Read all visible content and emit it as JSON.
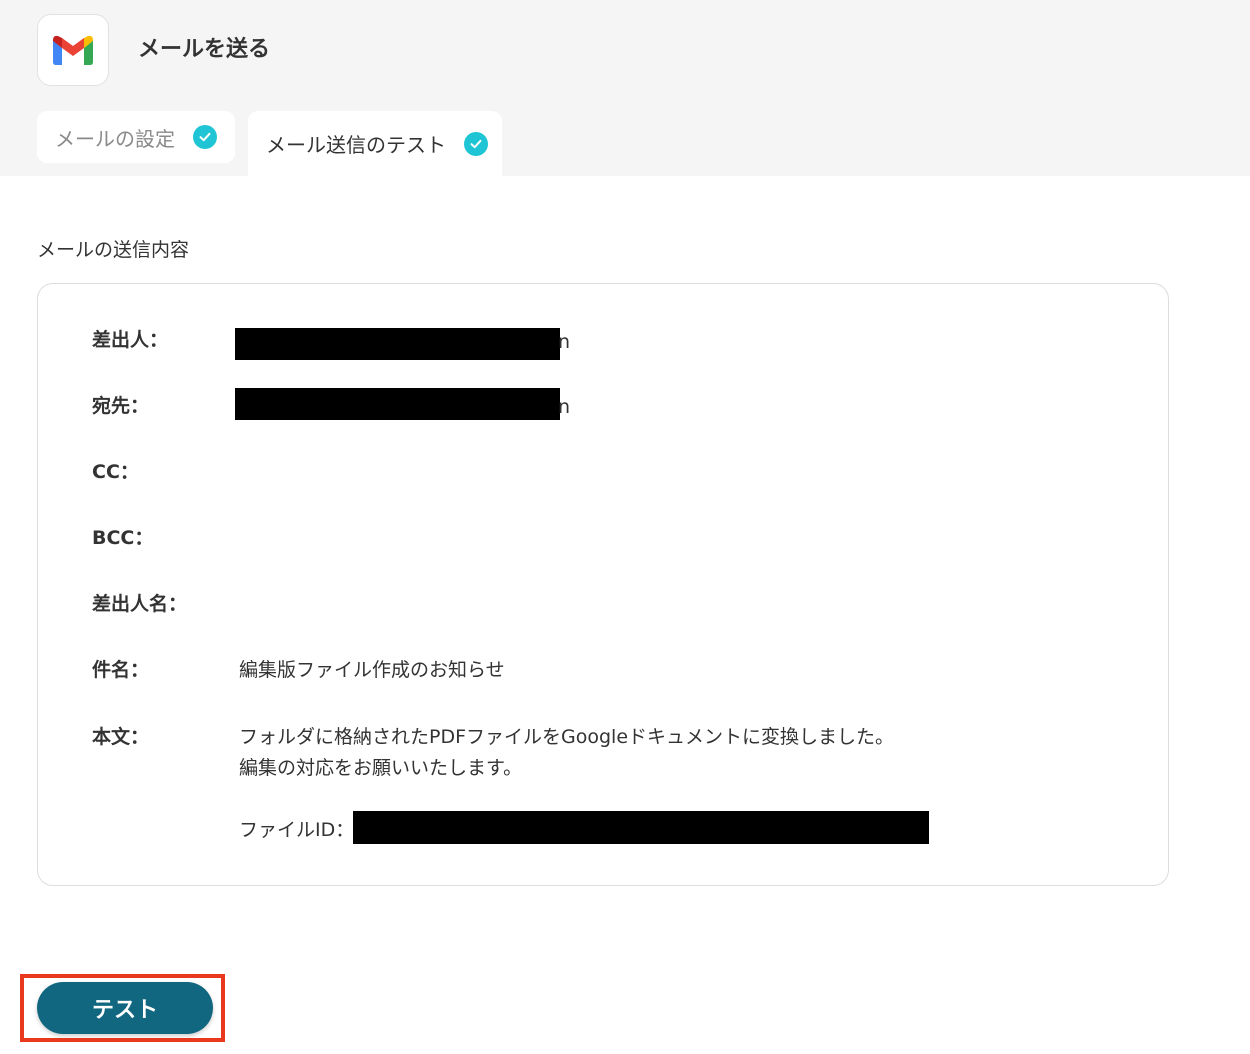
{
  "header": {
    "app_icon": "gmail-icon",
    "title": "メールを送る"
  },
  "tabs": [
    {
      "label": "メールの設定",
      "status_icon": "check-circle-icon",
      "active": false
    },
    {
      "label": "メール送信のテスト",
      "status_icon": "check-circle-icon",
      "active": true
    }
  ],
  "section": {
    "title": "メールの送信内容"
  },
  "fields": {
    "from": {
      "label": "差出人：",
      "tail": "n"
    },
    "to": {
      "label": "宛先：",
      "tail": "n"
    },
    "cc": {
      "label": "CC："
    },
    "bcc": {
      "label": "BCC："
    },
    "sender_name": {
      "label": "差出人名："
    },
    "subject": {
      "label": "件名：",
      "value": "編集版ファイル作成のお知らせ"
    },
    "body": {
      "label": "本文：",
      "line1": "フォルダに格納されたPDFファイルをGoogleドキュメントに変換しました。",
      "line2": "編集の対応をお願いいたします。",
      "file_id_prefix": "ファイルID：1"
    }
  },
  "actions": {
    "test_label": "テスト"
  },
  "colors": {
    "accent": "#11677f",
    "check": "#1fc5d4",
    "highlight": "#e8391f"
  }
}
